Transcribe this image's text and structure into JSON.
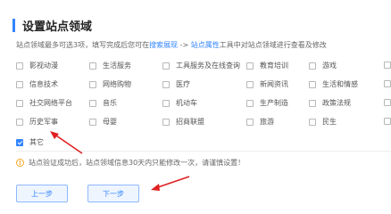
{
  "section": {
    "title": "设置站点领域",
    "desc_before": "站点领域最多可选3项，填写完成后您可在",
    "desc_link1": "搜索展现",
    "desc_mid": " -> ",
    "desc_link2": "站点属性",
    "desc_after": "工具中对站点领域进行查看及修改"
  },
  "categories": [
    {
      "label": "影视动漫",
      "checked": false
    },
    {
      "label": "生活服务",
      "checked": false
    },
    {
      "label": "工具服务及在线查询",
      "checked": false
    },
    {
      "label": "教育培训",
      "checked": false
    },
    {
      "label": "游戏",
      "checked": false
    },
    {
      "label": "信息技术",
      "checked": false
    },
    {
      "label": "网络购物",
      "checked": false
    },
    {
      "label": "医疗",
      "checked": false
    },
    {
      "label": "新闻资讯",
      "checked": false
    },
    {
      "label": "生活和情感",
      "checked": false
    },
    {
      "label": "社交网络平台",
      "checked": false
    },
    {
      "label": "音乐",
      "checked": false
    },
    {
      "label": "机动车",
      "checked": false
    },
    {
      "label": "生产制造",
      "checked": false
    },
    {
      "label": "政策法规",
      "checked": false
    },
    {
      "label": "历史军事",
      "checked": false
    },
    {
      "label": "母婴",
      "checked": false
    },
    {
      "label": "招商联盟",
      "checked": false
    },
    {
      "label": "旅游",
      "checked": false
    },
    {
      "label": "民生",
      "checked": false
    },
    {
      "label": "其它",
      "checked": true
    }
  ],
  "notice": {
    "icon": "info-icon",
    "text": "站点验证成功后，站点领域信息30天内只能修改一次，请谨慎设置！"
  },
  "buttons": {
    "prev_label": "上一步",
    "next_label": "下一步"
  },
  "colors": {
    "accent": "#3385ff",
    "annotation_arrow": "#e02020",
    "warning": "#f5a623"
  }
}
